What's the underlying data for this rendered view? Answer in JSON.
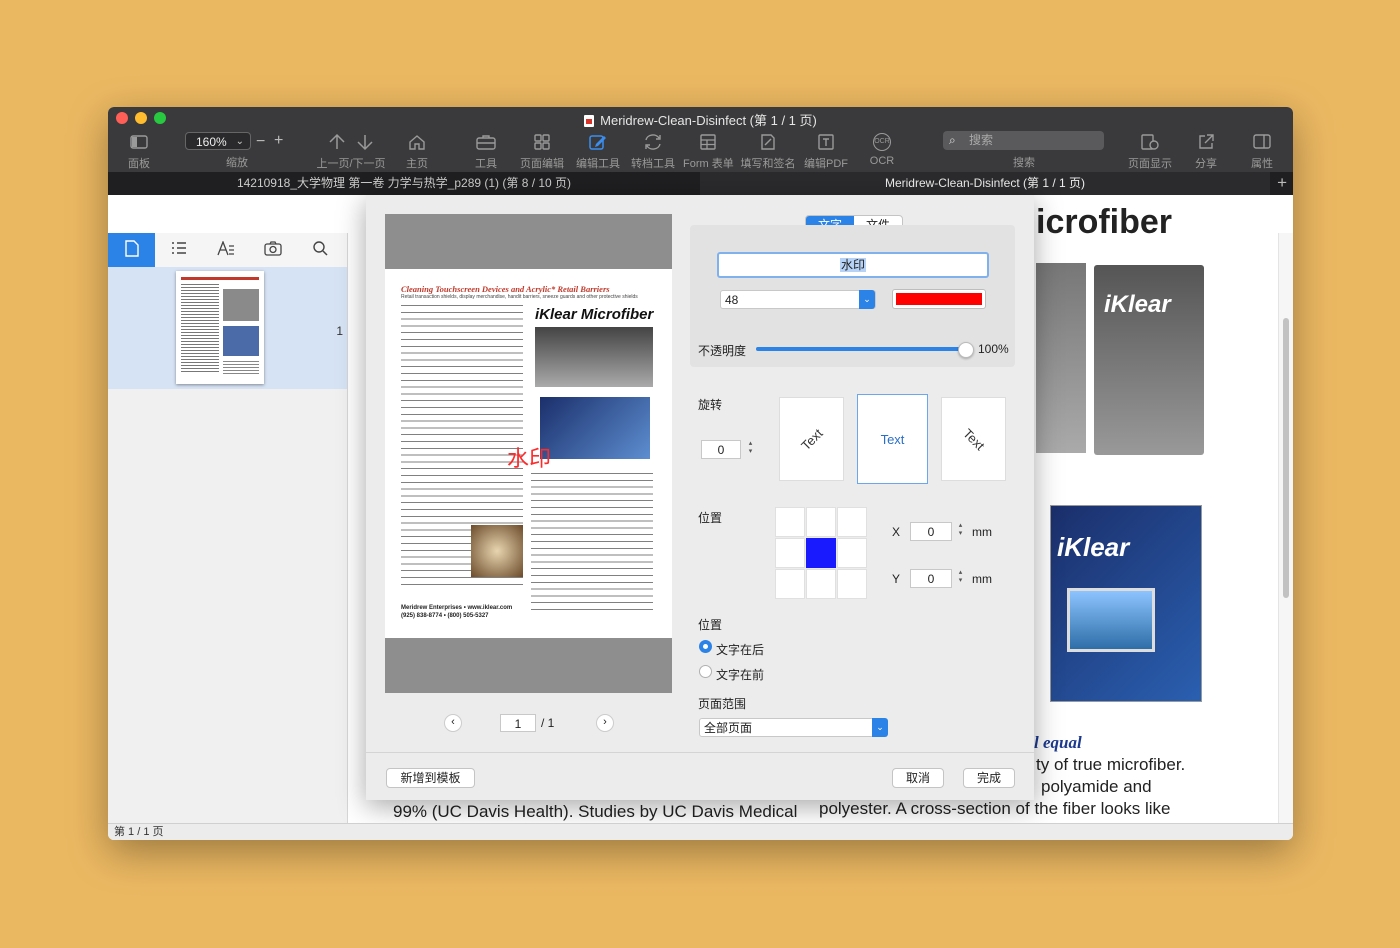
{
  "window": {
    "title": "Meridrew-Clean-Disinfect (第 1 / 1 页)",
    "traffic": {
      "close": "#ff5f57",
      "minimize": "#febc2e",
      "zoom": "#28c840"
    }
  },
  "toolbar": {
    "panel_label": "面板",
    "zoom_value": "160%",
    "zoom_label": "缩放",
    "prevnext_label": "上一页/下一页",
    "home_label": "主页",
    "tools_label": "工具",
    "page_edit_label": "页面编辑",
    "edit_tools_label": "编辑工具",
    "convert_label": "转档工具",
    "form_label": "Form 表单",
    "fill_sign_label": "填写和签名",
    "edit_pdf_label": "编辑PDF",
    "ocr_icon_text": "OCR",
    "ocr_label": "OCR",
    "search_placeholder": "搜索",
    "search_label": "搜索",
    "page_display_label": "页面显示",
    "share_label": "分享",
    "properties_label": "属性"
  },
  "tabs": [
    {
      "label": "14210918_大学物理 第一卷 力学与热学_p289 (1) (第 8 / 10 页)",
      "active": false
    },
    {
      "label": "Meridrew-Clean-Disinfect (第 1 / 1 页)",
      "active": true
    }
  ],
  "sidebar": {
    "icons": [
      "page-icon",
      "list-icon",
      "text-icon",
      "camera-icon",
      "search-icon"
    ],
    "page_number": "1"
  },
  "status": {
    "text": "第 1 / 1 页"
  },
  "background_doc": {
    "heading_fragment": "icrofiber",
    "equal_text": "l equal",
    "line1": "ty of true microfiber.",
    "line2": "polyamide and",
    "line3": "polyester. A cross-section of the fiber looks like",
    "left_line": "99% (UC Davis Health). Studies by UC Davis Medical"
  },
  "dialog": {
    "preview": {
      "page_title": "Cleaning Touchscreen Devices and Acrylic* Retail Barriers",
      "page_subtitle": "Retail transaction shields, display merchandise, handit barriers, sneeze guards and other protective shields",
      "brand": "iKlear Microfiber",
      "watermark": "水印",
      "footer": "Meridrew Enterprises • www.iklear.com",
      "footer2": "(925) 838-8774 • (800) 505-5327",
      "page_input": "1",
      "page_total": "/ 1"
    },
    "segment": {
      "text_tab": "文字",
      "file_tab": "文件"
    },
    "watermark_text": "水印",
    "font_size": "48",
    "color": "#ff0000",
    "opacity_label": "不透明度",
    "opacity_value": "100%",
    "opacity": 1.0,
    "rotation_label": "旋转",
    "rotation_value": "0",
    "rotation_samples": [
      "Text",
      "Text",
      "Text"
    ],
    "position_label": "位置",
    "x_label": "X",
    "x_value": "0",
    "y_label": "Y",
    "y_value": "0",
    "unit": "mm",
    "layer_label": "位置",
    "behind_text": "文字在后",
    "front_text": "文字在前",
    "page_range_label": "页面范围",
    "page_range_value": "全部页面",
    "add_template": "新增到模板",
    "cancel": "取消",
    "done": "完成"
  }
}
